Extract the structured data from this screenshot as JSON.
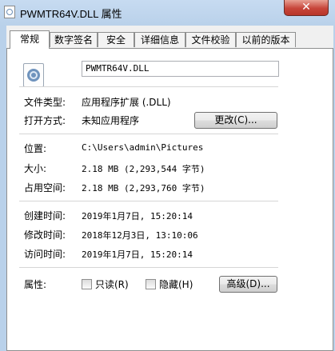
{
  "window": {
    "title": "PWMTR64V.DLL 属性",
    "close_glyph": "✕"
  },
  "tabs": [
    "常规",
    "数字签名",
    "安全",
    "详细信息",
    "文件校验",
    "以前的版本"
  ],
  "general": {
    "file_name": "PWMTR64V.DLL",
    "type_label": "文件类型:",
    "type_value": "应用程序扩展 (.DLL)",
    "opens_label": "打开方式:",
    "opens_value": "未知应用程序",
    "change_button": "更改(C)...",
    "location_label": "位置:",
    "location_value": "C:\\Users\\admin\\Pictures",
    "size_label": "大小:",
    "size_value": "2.18 MB (2,293,544 字节)",
    "disk_label": "占用空间:",
    "disk_value": "2.18 MB (2,293,760 字节)",
    "created_label": "创建时间:",
    "created_value": "2019年1月7日, 15:20:14",
    "modified_label": "修改时间:",
    "modified_value": "2018年12月3日, 13:10:06",
    "accessed_label": "访问时间:",
    "accessed_value": "2019年1月7日, 15:20:14",
    "attributes_label": "属性:",
    "readonly_label": "只读(R)",
    "readonly_checked": false,
    "hidden_label": "隐藏(H)",
    "hidden_checked": false,
    "advanced_button": "高级(D)..."
  }
}
